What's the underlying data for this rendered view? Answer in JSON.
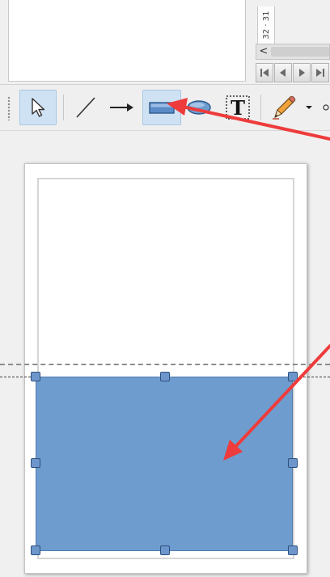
{
  "ruler": {
    "label": "32 · 31"
  },
  "scroll": {
    "left_arrow": "<"
  },
  "navigation": {
    "first": "first-page-icon",
    "previous": "previous-page-icon",
    "next": "next-page-icon",
    "last": "last-page-icon"
  },
  "toolbar": {
    "tools": [
      {
        "name": "select",
        "icon": "arrow-pointer-icon",
        "active": true
      },
      {
        "name": "line",
        "icon": "line-icon",
        "active": false
      },
      {
        "name": "arrow",
        "icon": "arrow-line-icon",
        "active": false
      },
      {
        "name": "rectangle",
        "icon": "rectangle-icon",
        "active": true
      },
      {
        "name": "ellipse",
        "icon": "ellipse-icon",
        "active": false
      },
      {
        "name": "text",
        "icon": "text-box-icon",
        "active": false
      },
      {
        "name": "pencil",
        "icon": "pencil-icon",
        "active": false
      }
    ],
    "text_tool_glyph": "T"
  },
  "canvas": {
    "shape": {
      "type": "rectangle",
      "fill": "#6f9cce",
      "border": "#4f7aae",
      "selected": true
    },
    "handle_color": "#6d97cc"
  },
  "colors": {
    "annotation_arrow": "#ee3b3b",
    "selection_highlight": "#cfe2f3"
  }
}
